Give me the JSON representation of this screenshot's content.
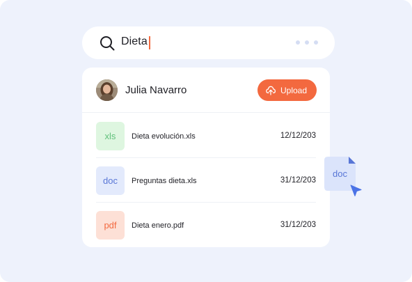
{
  "search": {
    "query": "Dieta"
  },
  "user": {
    "name": "Julia Navarro",
    "upload_label": "Upload"
  },
  "files": [
    {
      "type": "xls",
      "name": "Dieta evolución.xls",
      "date": "12/12/203",
      "badge_bg": "#def6e0",
      "badge_fg": "#5fc07a"
    },
    {
      "type": "doc",
      "name": "Preguntas dieta.xls",
      "date": "31/12/203",
      "badge_bg": "#e3eafc",
      "badge_fg": "#5876d6"
    },
    {
      "type": "pdf",
      "name": "Dieta enero.pdf",
      "date": "31/12/203",
      "badge_bg": "#fde0d6",
      "badge_fg": "#f3693f"
    }
  ],
  "dragging": {
    "label": "doc"
  },
  "colors": {
    "accent": "#f3693f",
    "background": "#eef2fc",
    "doc_blue": "#5876d6"
  },
  "icons": {
    "search": "search-icon",
    "upload": "upload-icon",
    "more": "more-dots-icon",
    "cursor": "cursor-icon"
  }
}
